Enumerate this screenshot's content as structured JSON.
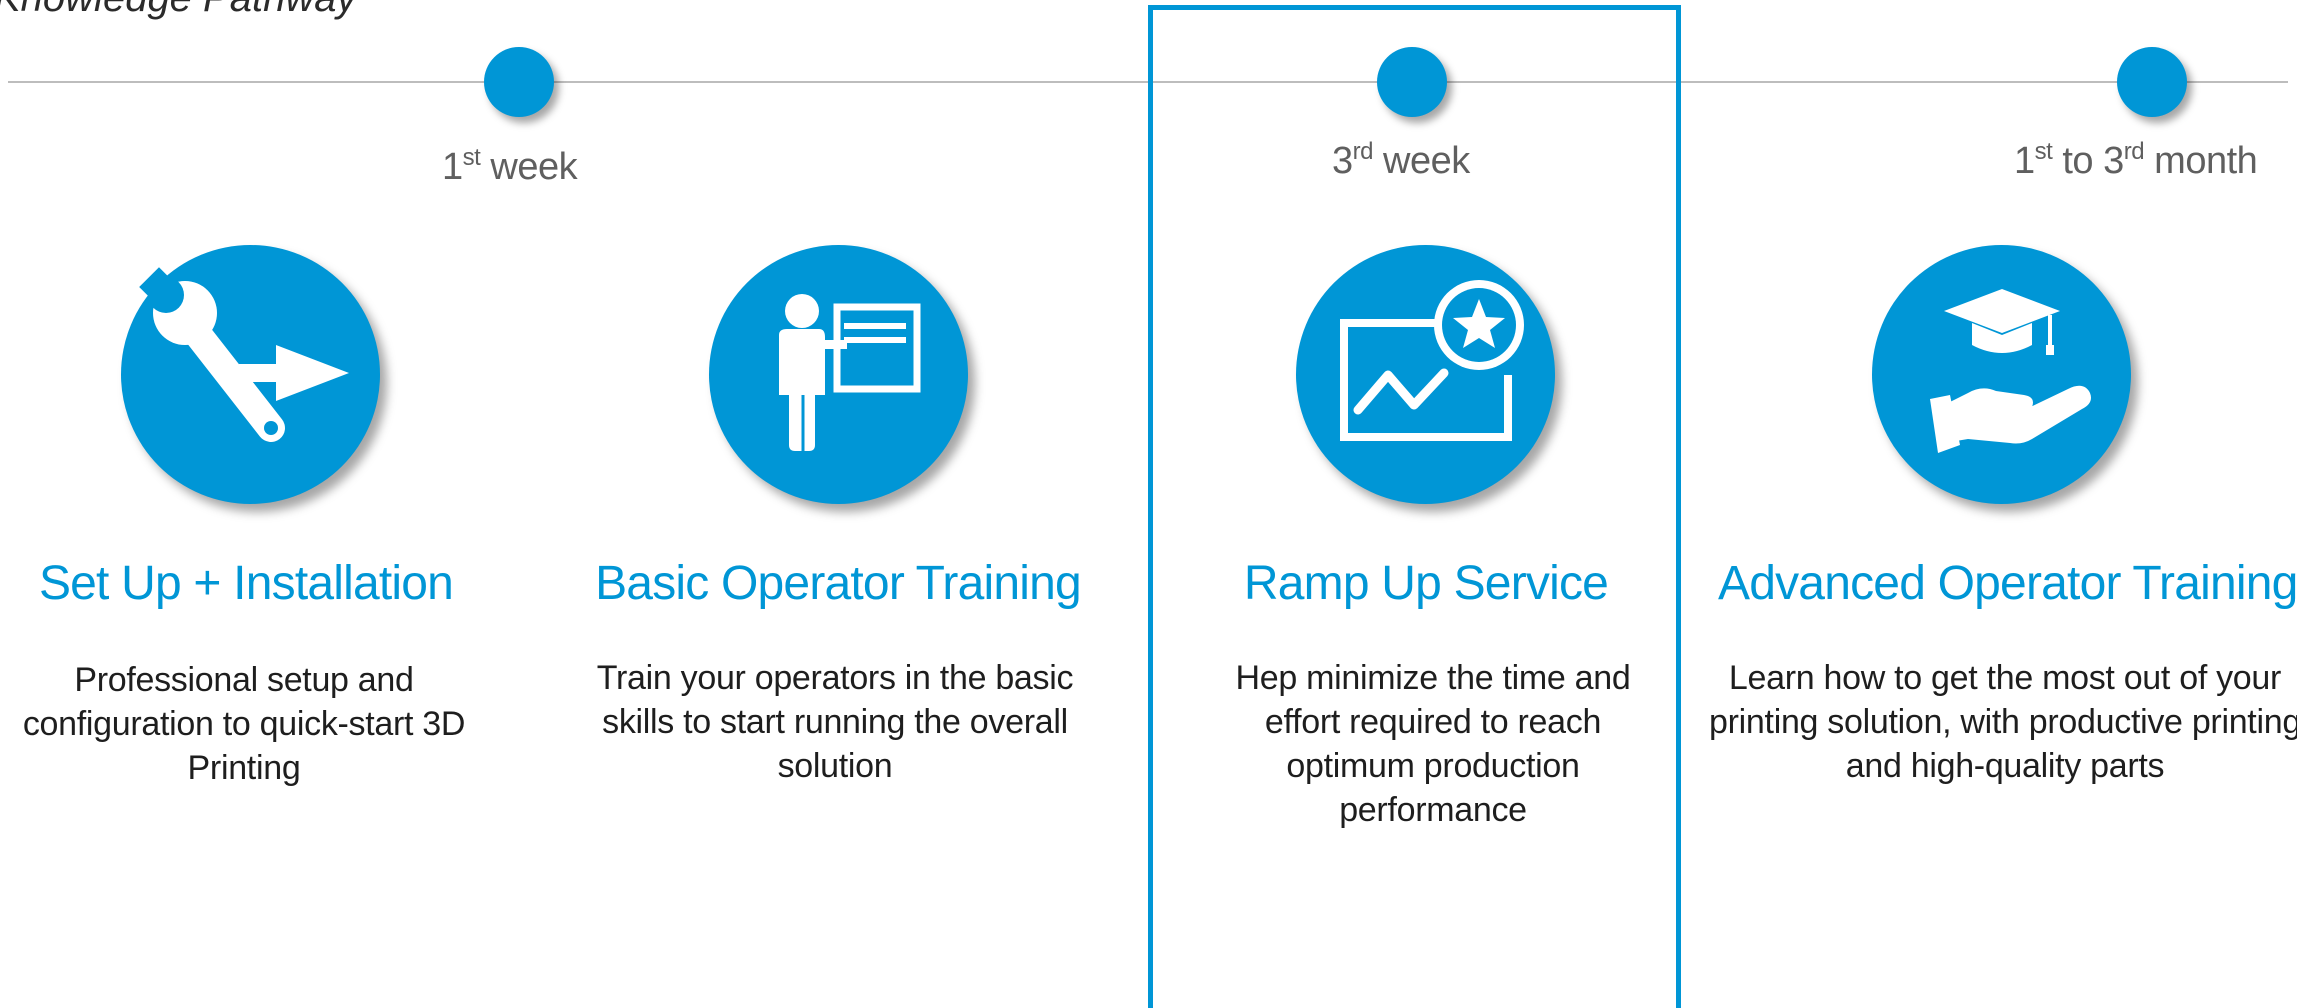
{
  "page": {
    "title": "Knowledge Pathway",
    "accent_color": "#0096d6"
  },
  "timeline": {
    "milestones": [
      {
        "number": "1",
        "suffix": "st",
        "label": " week"
      },
      {
        "number": "3",
        "suffix": "rd",
        "label": " week"
      },
      {
        "number": "1",
        "suffix": "st",
        "middle": " to 3",
        "suffix2": "rd",
        "label": " month"
      }
    ]
  },
  "steps": [
    {
      "icon": "wrench-arrow-icon",
      "title": "Set Up + Installation",
      "description": "Professional setup and configuration to quick-start 3D Printing"
    },
    {
      "icon": "presenter-board-icon",
      "title": "Basic Operator Training",
      "description": "Train your operators in the basic skills to start running the overall solution"
    },
    {
      "icon": "chart-star-icon",
      "title": "Ramp Up Service",
      "description": "Hep minimize the time and effort required to reach optimum production performance",
      "highlighted": true
    },
    {
      "icon": "graduation-hand-icon",
      "title": "Advanced Operator Training",
      "description": "Learn how to get the most out of your printing solution, with productive printing and high-quality parts"
    }
  ]
}
